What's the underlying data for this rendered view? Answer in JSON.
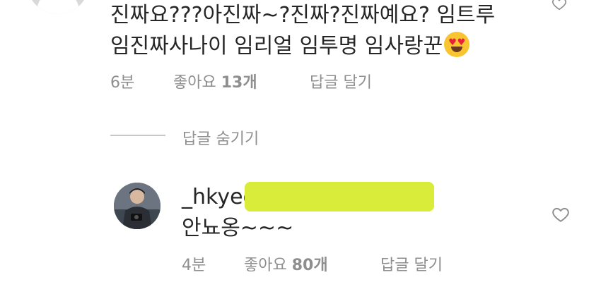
{
  "first_comment": {
    "text_line1": "진짜요???아진짜~?진짜?진짜예요? 임트루",
    "text_line2": "임진짜사나이 임리얼 임투명 임사랑꾼",
    "time": "6분",
    "likes_label": "좋아요 ",
    "likes_count": "13개",
    "reply_label": "답글 달기"
  },
  "hide_replies_label": "답글 숨기기",
  "reply": {
    "username": "_hkyeo",
    "text": "안뇨옹~~~",
    "time": "4분",
    "likes_label": "좋아요 ",
    "likes_count": "80개",
    "reply_label": "답글 달기"
  },
  "colors": {
    "text": "#262626",
    "meta": "#8e8e8e",
    "highlight": "#d9ec3a"
  }
}
